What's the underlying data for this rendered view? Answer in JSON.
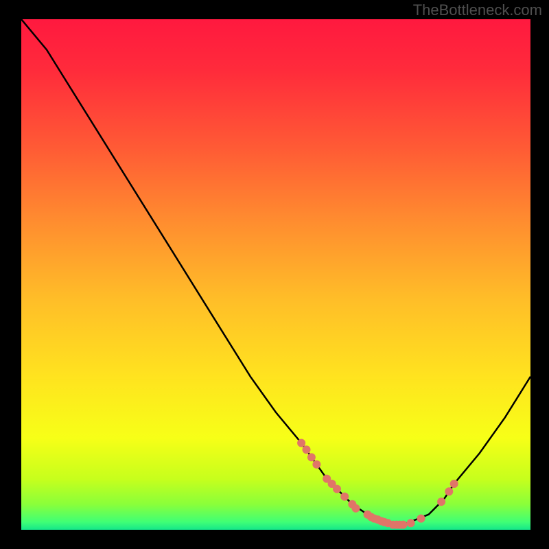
{
  "watermark": "TheBottleneck.com",
  "colors": {
    "bg": "#000000",
    "curve": "#000000",
    "marker": "#e07568",
    "gradient_stops": [
      {
        "offset": 0.0,
        "color": "#ff193f"
      },
      {
        "offset": 0.1,
        "color": "#ff2b3b"
      },
      {
        "offset": 0.25,
        "color": "#ff5a35"
      },
      {
        "offset": 0.4,
        "color": "#ff8e2f"
      },
      {
        "offset": 0.55,
        "color": "#ffbe28"
      },
      {
        "offset": 0.7,
        "color": "#ffe31f"
      },
      {
        "offset": 0.82,
        "color": "#f7ff17"
      },
      {
        "offset": 0.9,
        "color": "#c7ff1c"
      },
      {
        "offset": 0.95,
        "color": "#8aff3a"
      },
      {
        "offset": 0.985,
        "color": "#3fff76"
      },
      {
        "offset": 1.0,
        "color": "#15e68a"
      }
    ]
  },
  "chart_data": {
    "type": "line",
    "title": "",
    "xlabel": "",
    "ylabel": "",
    "xlim": [
      0,
      100
    ],
    "ylim": [
      0,
      100
    ],
    "x": [
      0,
      5,
      10,
      15,
      20,
      25,
      30,
      35,
      40,
      45,
      50,
      55,
      60,
      62,
      65,
      68,
      70,
      73,
      75,
      80,
      83,
      85,
      90,
      95,
      100
    ],
    "y": [
      100,
      94,
      86,
      78,
      70,
      62,
      54,
      46,
      38,
      30,
      23,
      17,
      10,
      8,
      5,
      3,
      2,
      1,
      1,
      3,
      6,
      9,
      15,
      22,
      30
    ],
    "markers": [
      {
        "x": 55,
        "y": 17
      },
      {
        "x": 56,
        "y": 15.7
      },
      {
        "x": 57,
        "y": 14.2
      },
      {
        "x": 58,
        "y": 12.8
      },
      {
        "x": 60,
        "y": 10
      },
      {
        "x": 61,
        "y": 9
      },
      {
        "x": 62,
        "y": 8
      },
      {
        "x": 63.5,
        "y": 6.5
      },
      {
        "x": 65,
        "y": 5
      },
      {
        "x": 65.7,
        "y": 4.2
      },
      {
        "x": 68,
        "y": 3
      },
      {
        "x": 68.7,
        "y": 2.5
      },
      {
        "x": 69.3,
        "y": 2.2
      },
      {
        "x": 70,
        "y": 2
      },
      {
        "x": 70.7,
        "y": 1.7
      },
      {
        "x": 71.3,
        "y": 1.5
      },
      {
        "x": 72,
        "y": 1.3
      },
      {
        "x": 73,
        "y": 1
      },
      {
        "x": 73.7,
        "y": 1
      },
      {
        "x": 74.3,
        "y": 1
      },
      {
        "x": 75,
        "y": 1
      },
      {
        "x": 76.5,
        "y": 1.3
      },
      {
        "x": 78.5,
        "y": 2.2
      },
      {
        "x": 82.5,
        "y": 5.5
      },
      {
        "x": 84,
        "y": 7.5
      },
      {
        "x": 85,
        "y": 9
      }
    ]
  }
}
